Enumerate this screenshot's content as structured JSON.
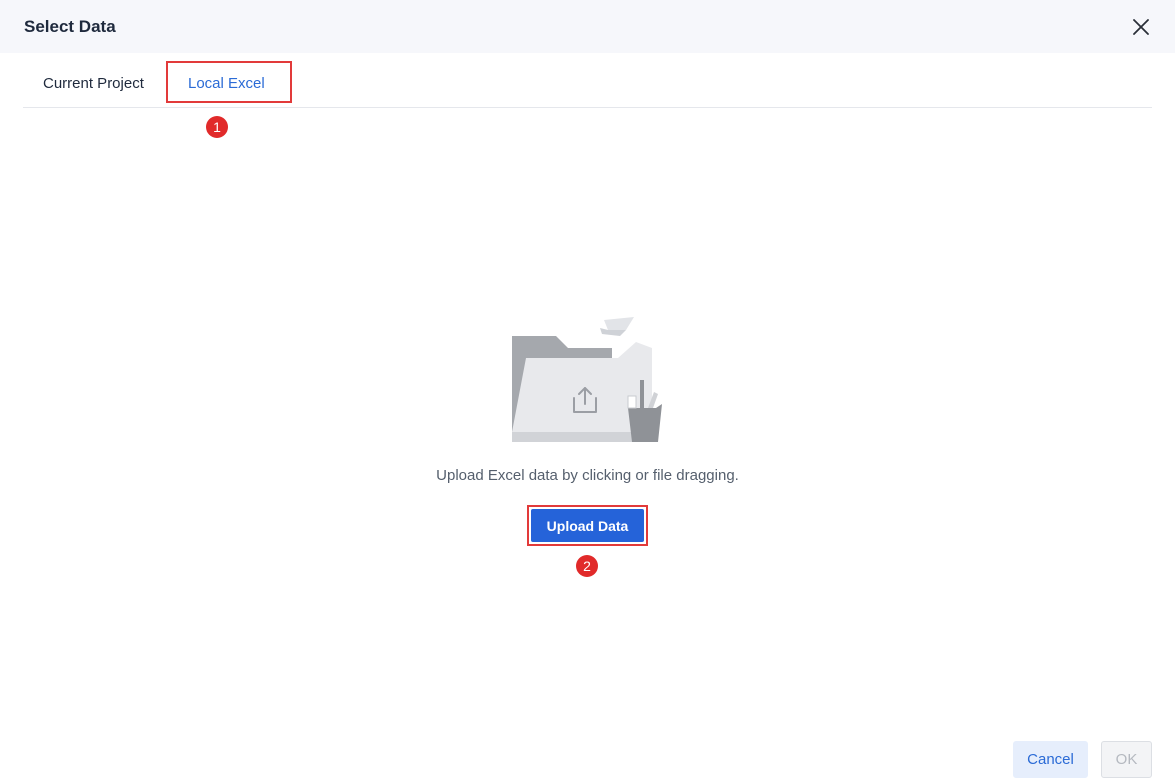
{
  "dialog": {
    "title": "Select Data",
    "close_icon": "close-icon"
  },
  "tabs": [
    {
      "label": "Current Project",
      "active": false
    },
    {
      "label": "Local Excel",
      "active": true
    }
  ],
  "annotations": {
    "marker_1": "1",
    "marker_2": "2",
    "highlight_color": "#e23a3a"
  },
  "upload": {
    "illustration_icon": "folder-upload-icon",
    "hint": "Upload Excel data by clicking or file dragging.",
    "button_label": "Upload Data"
  },
  "footer": {
    "cancel_label": "Cancel",
    "ok_label": "OK",
    "ok_disabled": true
  },
  "colors": {
    "accent": "#2563d9",
    "link": "#2b6bd6",
    "header_bg": "#f6f7fb"
  }
}
